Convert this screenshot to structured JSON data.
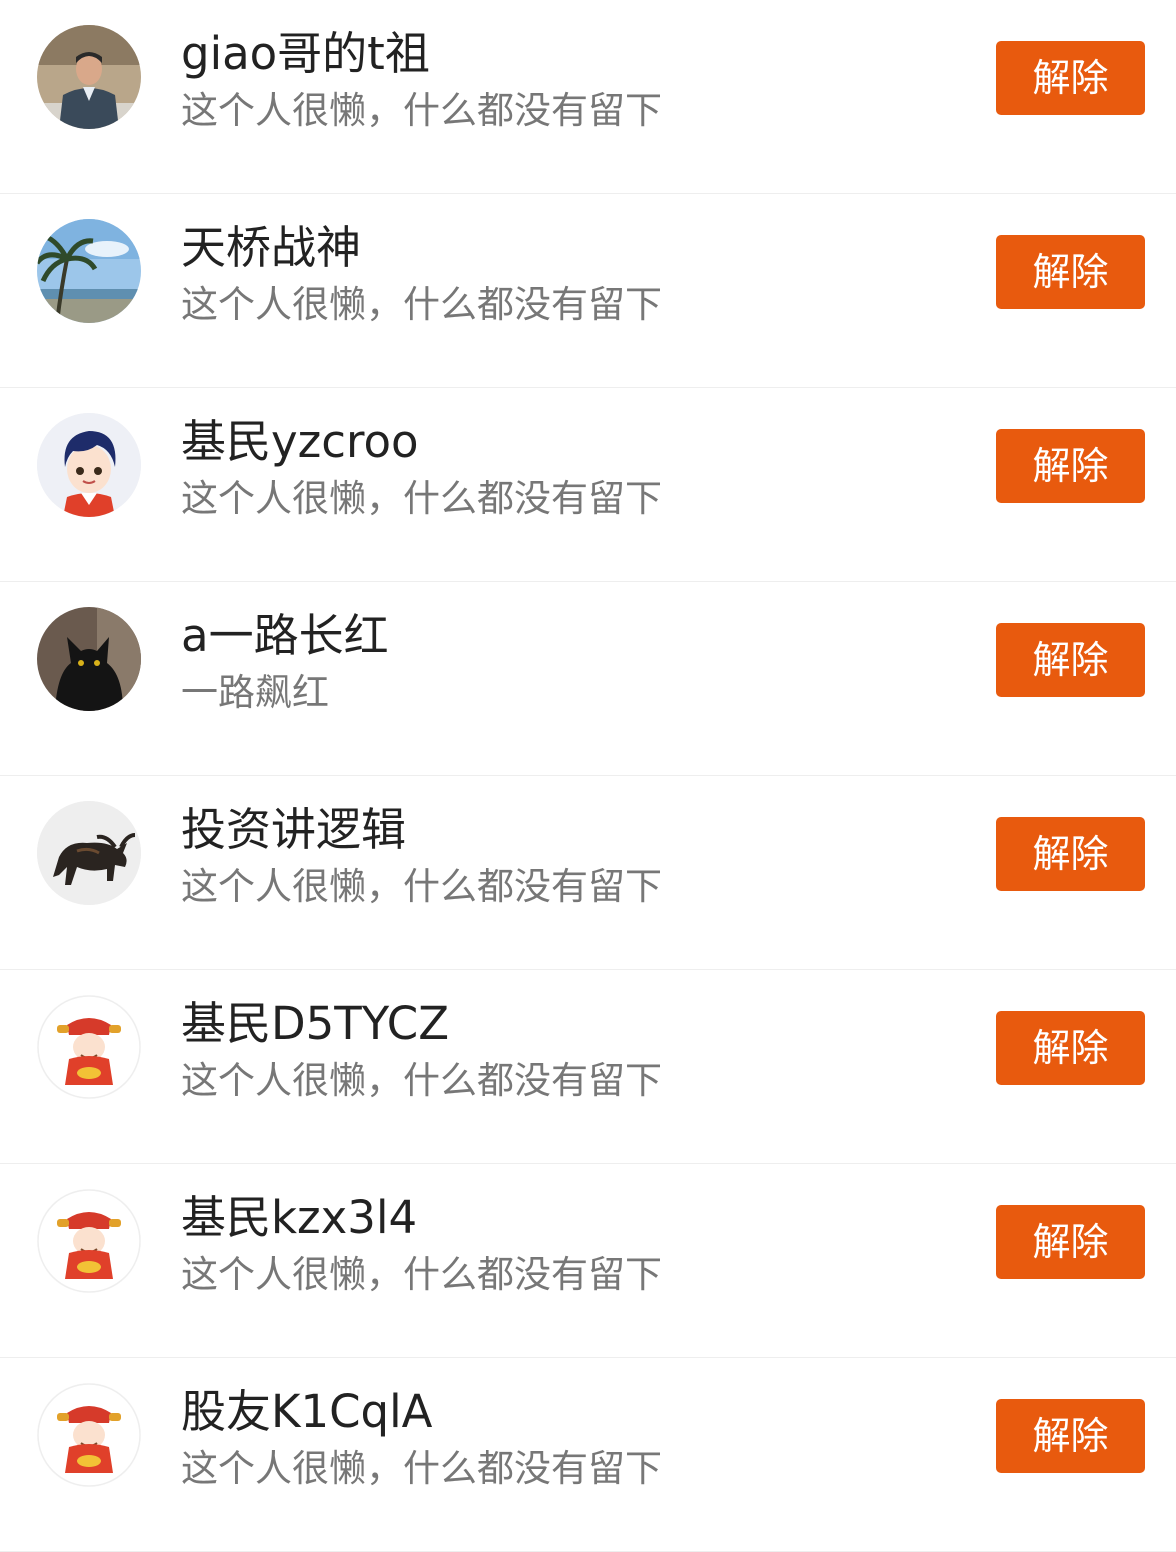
{
  "colors": {
    "accent": "#E85A0E",
    "name_text": "#222222",
    "bio_text": "#777777",
    "divider": "#EEEEEE"
  },
  "users": [
    {
      "name": "giao哥的t祖",
      "bio": "这个人很懒，什么都没有留下",
      "button_label": "解除",
      "avatar": "man-in-suit-photo"
    },
    {
      "name": "天桥战神",
      "bio": "这个人很懒，什么都没有留下",
      "button_label": "解除",
      "avatar": "palm-tree-beach-photo"
    },
    {
      "name": "基民yzcroo",
      "bio": "这个人很懒，什么都没有留下",
      "button_label": "解除",
      "avatar": "cartoon-boy-avatar"
    },
    {
      "name": "a一路长红",
      "bio": "一路飙红",
      "button_label": "解除",
      "avatar": "black-cat-photo"
    },
    {
      "name": "投资讲逻辑",
      "bio": "这个人很懒，什么都没有留下",
      "button_label": "解除",
      "avatar": "bull-statue"
    },
    {
      "name": "基民D5TYCZ",
      "bio": "这个人很懒，什么都没有留下",
      "button_label": "解除",
      "avatar": "god-of-wealth"
    },
    {
      "name": "基民kzx3l4",
      "bio": "这个人很懒，什么都没有留下",
      "button_label": "解除",
      "avatar": "god-of-wealth"
    },
    {
      "name": "股友K1CqlA",
      "bio": "这个人很懒，什么都没有留下",
      "button_label": "解除",
      "avatar": "god-of-wealth"
    }
  ]
}
